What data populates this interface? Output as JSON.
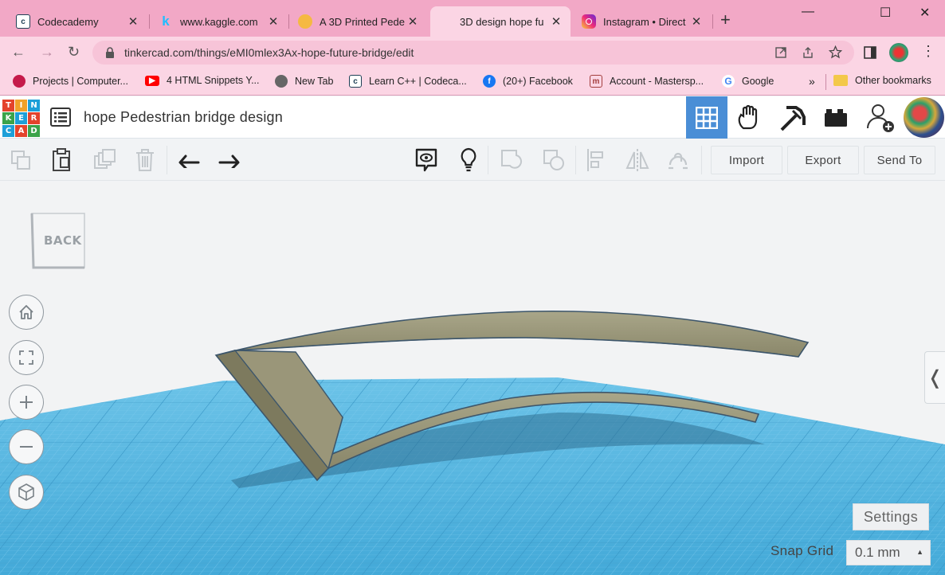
{
  "browser": {
    "tabs": [
      {
        "title": "Codecademy",
        "favicon": "codecademy-icon",
        "fav_color": "#1f4056"
      },
      {
        "title": "www.kaggle.com",
        "favicon": "kaggle-icon",
        "fav_color": "#20beff"
      },
      {
        "title": "A 3D Printed Pede",
        "favicon": "emoji-person-icon",
        "fav_color": "#f5b942"
      },
      {
        "title": "3D design hope fu",
        "favicon": "tinkercad-icon",
        "fav_color": "#e4432c"
      },
      {
        "title": "Instagram • Direct",
        "favicon": "instagram-icon",
        "fav_color": "#d6287a"
      }
    ],
    "new_tab_symbol": "+",
    "window_controls": {
      "minimize": "—",
      "maximize": "☐",
      "close": "✕"
    },
    "url": "tinkercad.com/things/eMI0mlex3Ax-hope-future-bridge/edit",
    "bookmarks": [
      {
        "label": "Projects | Computer...",
        "icon": "raspberry-icon",
        "color": "#c51a4a"
      },
      {
        "label": "4 HTML Snippets Y...",
        "icon": "youtube-icon",
        "color": "#ff0000"
      },
      {
        "label": "New Tab",
        "icon": "globe-icon",
        "color": "#555555"
      },
      {
        "label": "Learn C++ | Codeca...",
        "icon": "codecademy-icon",
        "color": "#1f4056"
      },
      {
        "label": "(20+) Facebook",
        "icon": "facebook-icon",
        "color": "#1877f2"
      },
      {
        "label": "Account - Mastersp...",
        "icon": "bank-icon",
        "color": "#a33e3e"
      },
      {
        "label": "Google",
        "icon": "google-icon",
        "color": "#4285f4"
      }
    ],
    "bookmarks_overflow": "»",
    "other_bookmarks": "Other bookmarks"
  },
  "app": {
    "logo_letters": [
      "TIN",
      "KER",
      "CAD"
    ],
    "logo_cells": [
      "T",
      "I",
      "N",
      "K",
      "E",
      "R",
      "C",
      "A",
      "D"
    ],
    "design_title": "hope Pedestrian bridge design",
    "toolbar": {
      "import_label": "Import",
      "export_label": "Export",
      "send_to_label": "Send To"
    },
    "viewcube_label": "BACK",
    "settings_label": "Settings",
    "snap_grid_label": "Snap Grid",
    "snap_grid_value": "0.1 mm",
    "side_panel_toggle": "❬"
  },
  "colors": {
    "tab_bar": "#f2a8c6",
    "accent_blue": "#4a8ed6",
    "workplane": "#4fb3de",
    "bridge_shape": "#8e8b6d"
  }
}
